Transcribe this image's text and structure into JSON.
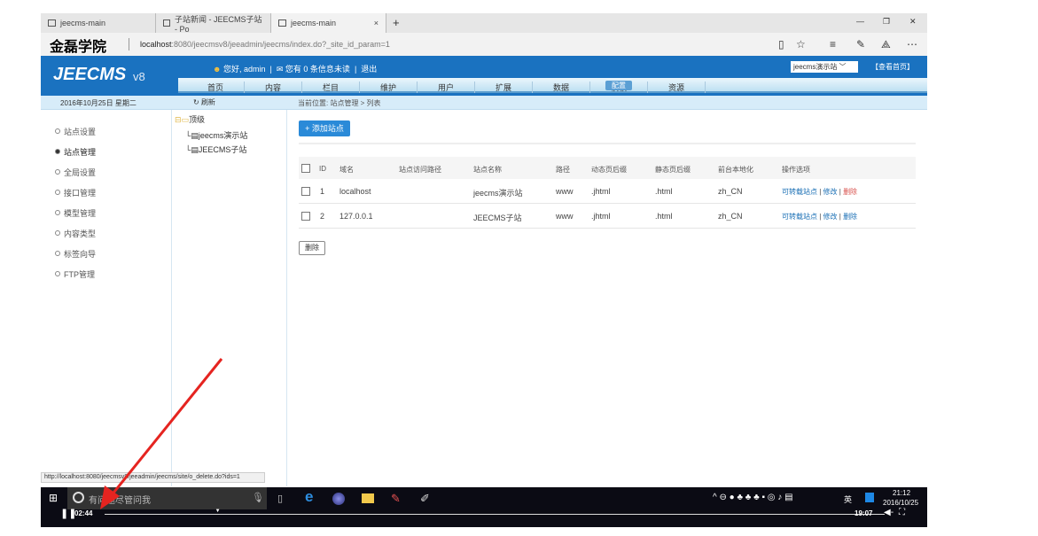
{
  "browser": {
    "tabs": [
      {
        "label": "jeecms-main"
      },
      {
        "label": "子站新闻 - JEECMS子站 - Po"
      },
      {
        "label": "jeecms-main"
      }
    ],
    "new_tab": "+",
    "close": "×",
    "url_host": "localhost",
    "url_rest": ":8080/jeecmsv8/jeeadmin/jeecms/index.do?_site_id_param=1",
    "watermark": "金磊学院",
    "win_controls": [
      "—",
      "❐",
      "✕"
    ]
  },
  "header": {
    "brand": "JEECMS",
    "version": "v8",
    "greeting": "您好, admin",
    "messages": "您有 0 条信息未读",
    "logout": "退出",
    "site_select": "jeecms演示站 ﹀",
    "view_home": "【查看首页】",
    "nav": [
      "首页",
      "内容",
      "栏目",
      "维护",
      "用户",
      "扩展",
      "数据",
      "模板",
      "资源",
      "配置"
    ]
  },
  "subbar": {
    "date": "2016年10月25日 星期二",
    "refresh": "刷新",
    "breadcrumb": "当前位置: 站点管理 > 列表"
  },
  "sidebar": {
    "items": [
      "站点设置",
      "站点管理",
      "全局设置",
      "接口管理",
      "模型管理",
      "内容类型",
      "标签向导",
      "FTP管理"
    ]
  },
  "tree": {
    "root": "顶级",
    "children": [
      "jeecms演示站",
      "JEECMS子站"
    ]
  },
  "main": {
    "add_label": "+ 添加站点",
    "delete_label": "删除",
    "columns": [
      "ID",
      "域名",
      "站点访问路径",
      "站点名称",
      "路径",
      "动态页后缀",
      "静态页后缀",
      "前台本地化",
      "操作选项"
    ],
    "rows": [
      {
        "id": "1",
        "domain": "localhost",
        "access_path": "",
        "name": "jeecms演示站",
        "path": "www",
        "dyn": ".jhtml",
        "static": ".html",
        "locale": "zh_CN",
        "a1": "可转载站点",
        "a2": "修改",
        "a3": "删除"
      },
      {
        "id": "2",
        "domain": "127.0.0.1",
        "access_path": "",
        "name": "JEECMS子站",
        "path": "www",
        "dyn": ".jhtml",
        "static": ".html",
        "locale": "zh_CN",
        "a1": "可转载站点",
        "a2": "修改",
        "a3": "删除"
      }
    ]
  },
  "status_url": "http://localhost:8080/jeecmsv8/jeeadmin/jeecms/site/o_delete.do?ids=1",
  "taskbar": {
    "search_placeholder": "有问题尽管问我",
    "time": "21:12",
    "date": "2016/10/25",
    "ime": "英"
  },
  "video": {
    "elapsed": "02:44",
    "total": "19:07",
    "progress": 0.145
  }
}
